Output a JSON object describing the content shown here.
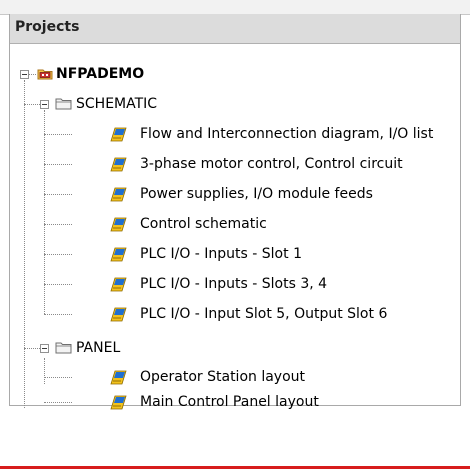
{
  "panel": {
    "title": "Projects"
  },
  "tree": {
    "project": {
      "label": "NFPADEMO",
      "icon": "project-folder-icon"
    },
    "folders": [
      {
        "label": "SCHEMATIC",
        "icon": "folder-icon",
        "items": [
          {
            "label": "Flow and Interconnection diagram, I/O list",
            "icon": "drawing-icon"
          },
          {
            "label": "3-phase motor control, Control circuit",
            "icon": "drawing-icon"
          },
          {
            "label": "Power supplies, I/O module feeds",
            "icon": "drawing-icon"
          },
          {
            "label": "Control schematic",
            "icon": "drawing-icon"
          },
          {
            "label": "PLC I/O - Inputs - Slot 1",
            "icon": "drawing-icon"
          },
          {
            "label": "PLC I/O - Inputs - Slots 3, 4",
            "icon": "drawing-icon"
          },
          {
            "label": "PLC I/O - Input Slot 5, Output Slot 6",
            "icon": "drawing-icon"
          }
        ]
      },
      {
        "label": "PANEL",
        "icon": "folder-icon",
        "items": [
          {
            "label": "Operator Station layout",
            "icon": "drawing-icon"
          },
          {
            "label": "Main Control Panel layout",
            "icon": "drawing-icon"
          }
        ]
      }
    ]
  },
  "colors": {
    "header_bg": "#dcdcdc",
    "folder_fill": "#f3f3f3",
    "drawing_yellow": "#f2c21d",
    "drawing_blue": "#1f6fd1",
    "project_red": "#c8312f",
    "bottom_accent": "#d71d1d"
  }
}
